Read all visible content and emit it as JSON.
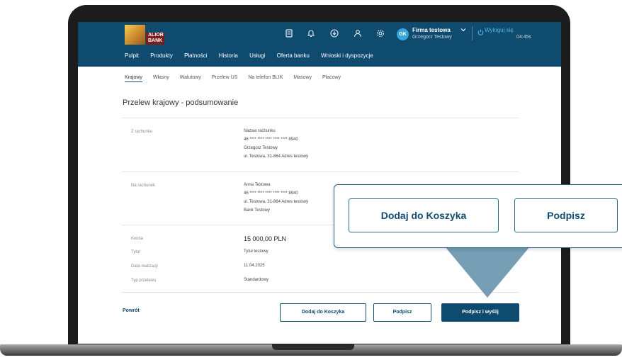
{
  "header": {
    "logo": {
      "line1": "ALIOR",
      "line2": "BANK"
    },
    "icons": [
      "calculator-icon",
      "bell-icon",
      "download-icon",
      "user-icon",
      "settings-icon"
    ],
    "avatar_initials": "GK",
    "company": "Firma testowa",
    "user_name": "Grzegorz Testowy",
    "logout_label": "Wyloguj się",
    "session_timer": "04:45s",
    "nav": [
      "Pulpit",
      "Produkty",
      "Płatności",
      "Historia",
      "Usługi",
      "Oferta banku",
      "Wnioski i dyspozycje"
    ]
  },
  "tabs": [
    "Krajowy",
    "Własny",
    "Walutowy",
    "Przelew US",
    "Na telefon BLIK",
    "Masowy",
    "Płacowy"
  ],
  "page_title": "Przelew krajowy - podsumowanie",
  "from": {
    "label": "Z rachunku",
    "lines": [
      "Nazwa rachunku",
      "46 **** **** **** **** **** 8940",
      "Grzegorz Testowy",
      "ul. Testowa, 31-864 Adres testowy"
    ]
  },
  "to": {
    "label": "Na rachunek",
    "lines": [
      "Anna Testowa",
      "46 **** **** **** **** **** 8940",
      "ul. Testowa, 31-864 Adres testowy",
      "Bank Testowy"
    ]
  },
  "details": {
    "amount_label": "Kwota",
    "amount_value": "15 000,00 PLN",
    "title_label": "Tytuł",
    "title_value": "Tytuł testowy",
    "date_label": "Data realizacji",
    "date_value": "11.04.2025",
    "type_label": "Typ przelewu",
    "type_value": "Standardowy"
  },
  "footer": {
    "back": "Powrót",
    "add_to_cart": "Dodaj do Koszyka",
    "sign": "Podpisz",
    "sign_send": "Podpisz i wyślij"
  },
  "callout": {
    "add_to_cart": "Dodaj do Koszyka",
    "sign": "Podpisz"
  },
  "colors": {
    "brand": "#0f4a6f",
    "accent": "#37a6d8"
  }
}
